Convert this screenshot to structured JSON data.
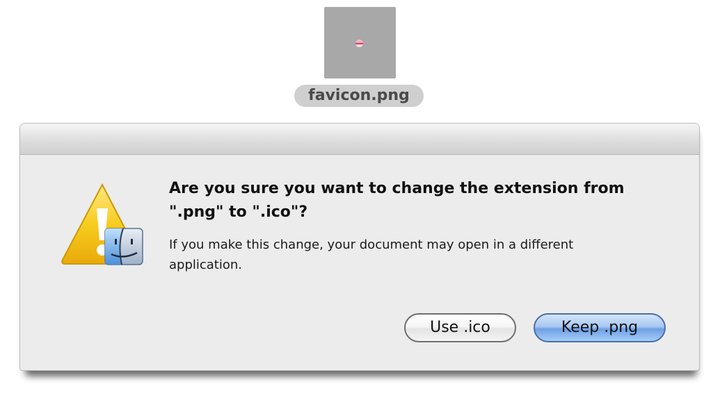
{
  "desktop_file": {
    "name": "favicon.png"
  },
  "alert": {
    "message": "Are you sure you want to change the extension from \".png\" to \".ico\"?",
    "informative": "If you make this change, your document may open in a different application.",
    "icon": "caution-icon",
    "badge_icon": "finder-icon",
    "buttons": {
      "secondary_label": "Use .ico",
      "default_label": "Keep .png"
    }
  },
  "colors": {
    "default_button": "#6fa0e5",
    "warning_yellow": "#f5c518"
  }
}
